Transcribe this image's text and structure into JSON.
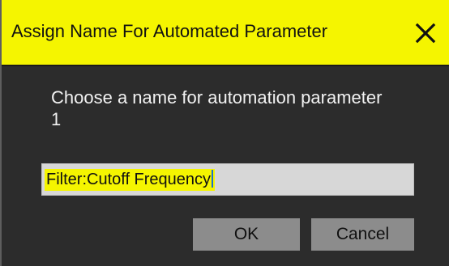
{
  "dialog": {
    "title": "Assign Name For Automated Parameter",
    "close_icon": "close-x-icon",
    "prompt": "Choose a name for automation parameter 1",
    "name_field": {
      "value": "Filter:Cutoff Frequency",
      "selected": true
    },
    "buttons": {
      "ok_label": "OK",
      "cancel_label": "Cancel"
    }
  },
  "colors": {
    "titlebar_bg": "#f5f500",
    "dialog_bg": "#2c2c2c",
    "button_bg": "#8c8c8c",
    "input_bg": "#d7d7d7",
    "selection_bg": "#f5f500"
  }
}
